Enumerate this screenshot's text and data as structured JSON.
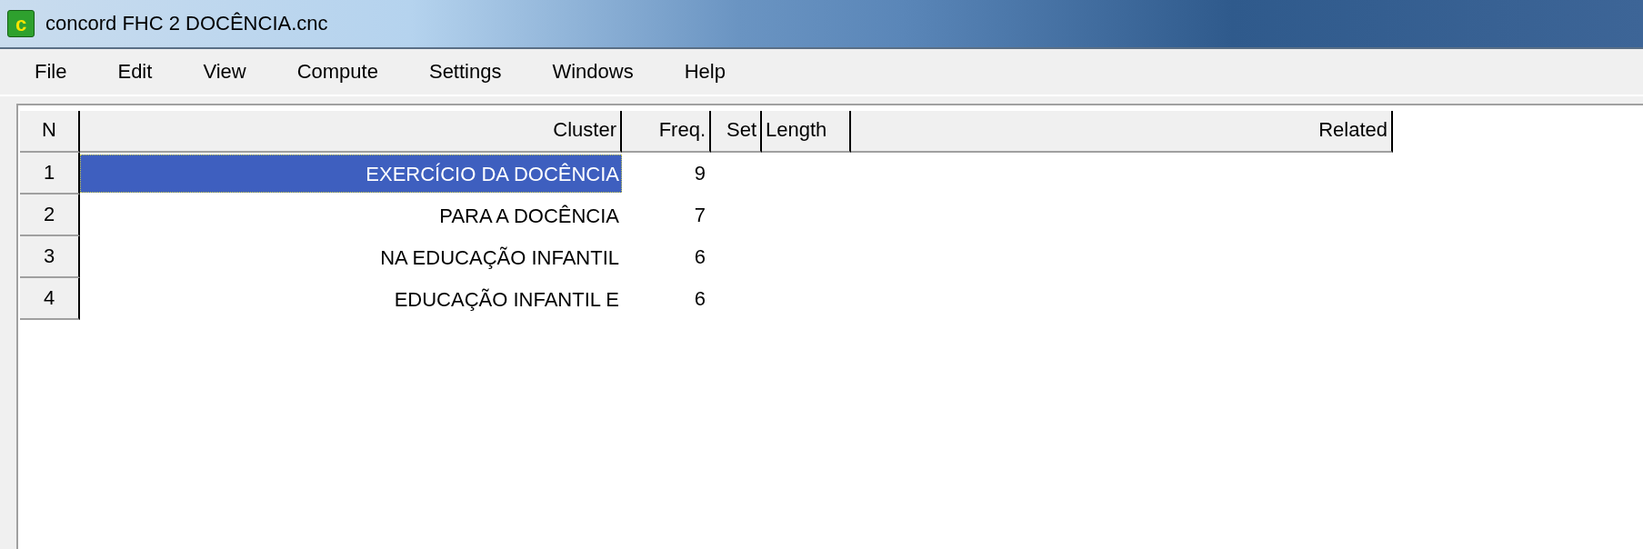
{
  "window": {
    "title": "concord FHC 2 DOCÊNCIA.cnc",
    "icon_letter": "c"
  },
  "menu": [
    "File",
    "Edit",
    "View",
    "Compute",
    "Settings",
    "Windows",
    "Help"
  ],
  "table": {
    "columns": [
      "N",
      "Cluster",
      "Freq.",
      "Set",
      "Length",
      "Related"
    ],
    "rows": [
      {
        "n": "1",
        "cluster": "EXERCÍCIO DA DOCÊNCIA",
        "freq": "9",
        "selected": true
      },
      {
        "n": "2",
        "cluster": "PARA A DOCÊNCIA",
        "freq": "7",
        "selected": false
      },
      {
        "n": "3",
        "cluster": "NA EDUCAÇÃO INFANTIL",
        "freq": "6",
        "selected": false
      },
      {
        "n": "4",
        "cluster": "EDUCAÇÃO INFANTIL E",
        "freq": "6",
        "selected": false
      }
    ]
  }
}
